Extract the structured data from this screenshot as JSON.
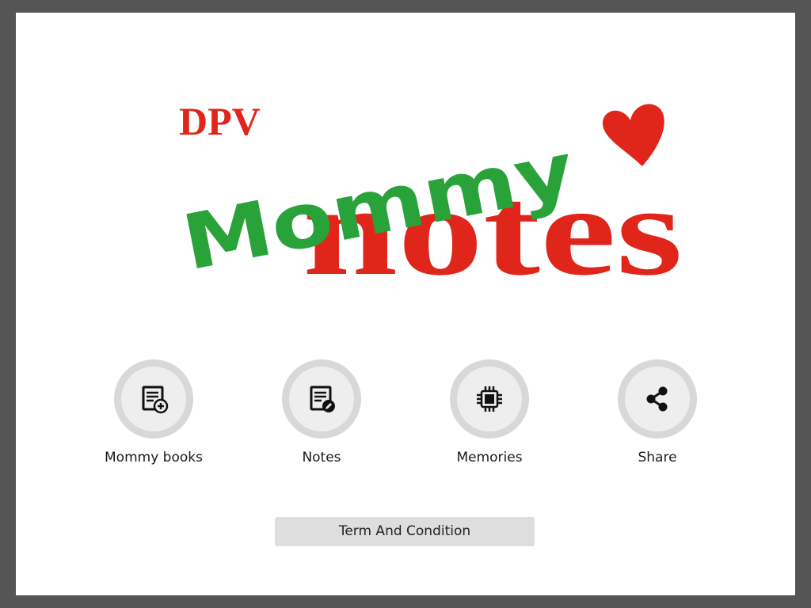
{
  "logo": {
    "brand": "DPV",
    "script_word": "Mommy",
    "main_word": "notes",
    "colors": {
      "red": "#e0261b",
      "green": "#2aa23a"
    }
  },
  "menu": [
    {
      "label": "Mommy books",
      "icon": "book-add-icon"
    },
    {
      "label": "Notes",
      "icon": "note-edit-icon"
    },
    {
      "label": "Memories",
      "icon": "chip-icon"
    },
    {
      "label": "Share",
      "icon": "share-icon"
    }
  ],
  "terms_button": {
    "label": "Term And Condition"
  }
}
